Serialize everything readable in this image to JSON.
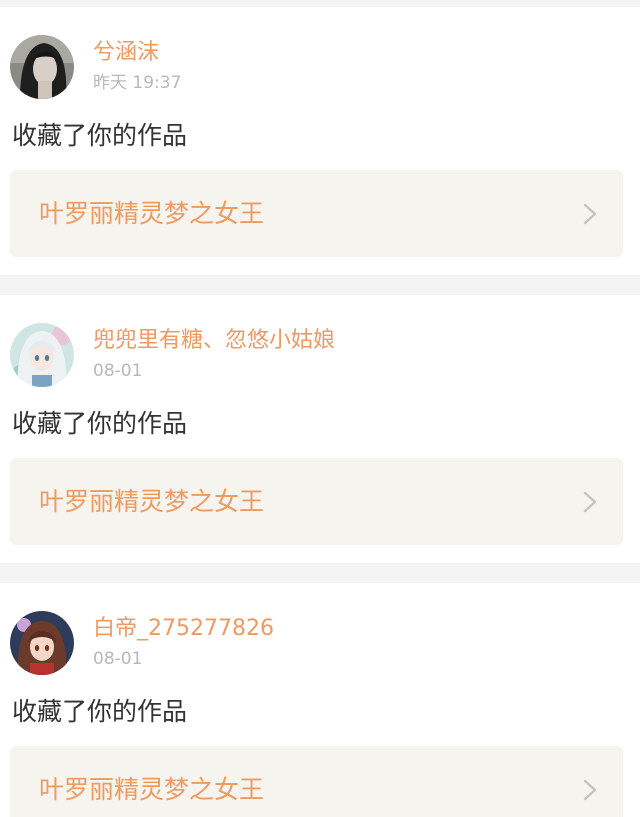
{
  "notifications": [
    {
      "avatar_icon": "avatar-dark-hair-portrait",
      "username": "兮涵沫",
      "time": "昨天 19:37",
      "action": "收藏了你的作品",
      "work_title": "叶罗丽精灵梦之女王",
      "chevron_icon": "chevron-right-icon"
    },
    {
      "avatar_icon": "avatar-anime-girl-white-hair",
      "username": "兜兜里有糖、忽悠小姑娘",
      "time": "08-01",
      "action": "收藏了你的作品",
      "work_title": "叶罗丽精灵梦之女王",
      "chevron_icon": "chevron-right-icon"
    },
    {
      "avatar_icon": "avatar-anime-girl-brown-hair",
      "username": "白帝_275277826",
      "time": "08-01",
      "action": "收藏了你的作品",
      "work_title": "叶罗丽精灵梦之女王",
      "chevron_icon": "chevron-right-icon"
    }
  ],
  "colors": {
    "page_background": "#f4f4f4",
    "card_background": "#ffffff",
    "accent_orange": "#ef9a60",
    "timestamp_gray": "#b8b8b8",
    "body_text": "#333333",
    "work_box_background": "#f5f4ef",
    "chevron_gray": "#c4c4c4"
  }
}
